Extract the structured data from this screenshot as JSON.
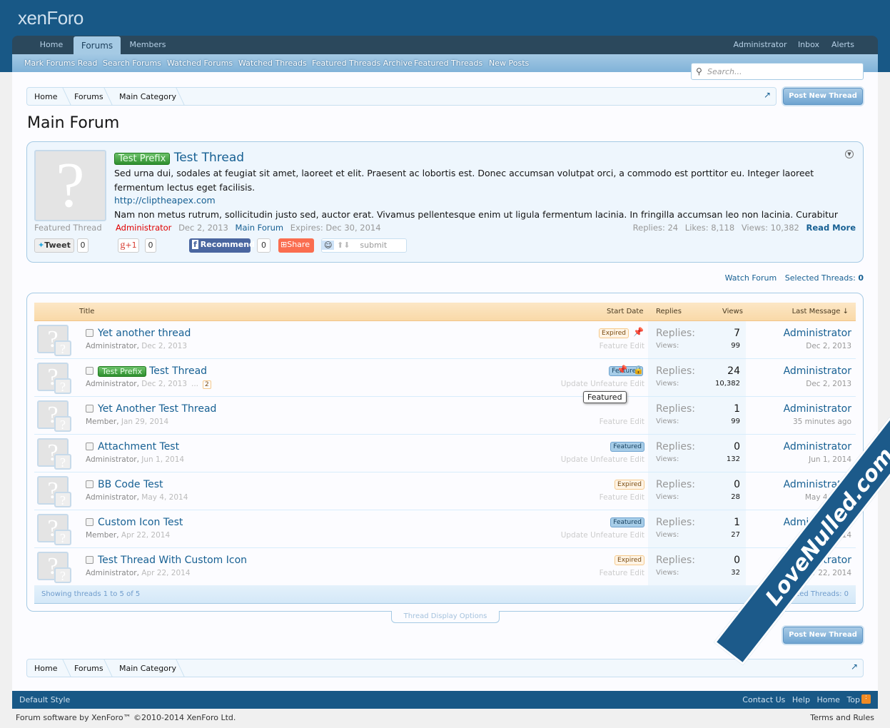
{
  "brand": {
    "logo": "xenForo"
  },
  "nav": {
    "tabs": [
      "Home",
      "Forums",
      "Members"
    ],
    "right": [
      "Administrator",
      "Inbox",
      "Alerts"
    ]
  },
  "subnav": [
    "Mark Forums Read",
    "Search Forums",
    "Watched Forums",
    "Watched Threads",
    "Featured Threads Archive",
    "Featured Threads",
    "New Posts"
  ],
  "search": {
    "placeholder": "Search..."
  },
  "breadcrumb": [
    "Home",
    "Forums",
    "Main Category"
  ],
  "post_button": "Post New Thread",
  "page_title": "Main Forum",
  "featured": {
    "prefix": "Test Prefix",
    "title": "Test Thread",
    "body1": "Sed urna dui, sodales at feugiat sit amet, laoreet et elit. Praesent ac lobortis est. Donec accumsan volutpat orci, a commodo est porttitor eu. Integer laoreet fermentum lectus eget facilisis.",
    "link": "http://cliptheapex.com",
    "body2": "Nam non metus rutrum, sollicitudin justo sed, auctor erat. Vivamus pellentesque enim ut ligula fermentum lacinia. In fringilla accumsan leo non lacinia. Curabitur",
    "label": "Featured Thread",
    "author": "Administrator",
    "date": "Dec 2, 2013",
    "forum": "Main Forum",
    "expires": "Expires: Dec 30, 2014",
    "replies": "Replies: 24",
    "likes": "Likes: 8,118",
    "views": "Views: 10,382",
    "read_more": "Read More",
    "share": {
      "tweet": "Tweet",
      "tweet_count": "0",
      "gplus": "+1",
      "gplus_count": "0",
      "recommend": "Recommend",
      "recommend_count": "0",
      "share": "Share",
      "submit": "submit"
    }
  },
  "list_controls": {
    "watch": "Watch Forum",
    "selected": "Selected Threads:",
    "selected_count": "0"
  },
  "columns": {
    "title": "Title",
    "start_date": "Start Date",
    "replies": "Replies",
    "views": "Views",
    "last_message": "Last Message ↓"
  },
  "stat_labels": {
    "replies": "Replies:",
    "views": "Views:"
  },
  "threads": [
    {
      "title": "Yet another thread",
      "prefix": "",
      "author": "Administrator",
      "date": "Dec 2, 2013",
      "badge": "Expired",
      "badge_type": "exp",
      "actions": "Feature Edit",
      "sticky": true,
      "locked": false,
      "replies": "7",
      "views": "99",
      "last_user": "Administrator",
      "last_date": "Dec 2, 2013"
    },
    {
      "title": "Test Thread",
      "prefix": "Test Prefix",
      "author": "Administrator",
      "date": "Dec 2, 2013",
      "pages": "2",
      "badge": "Featured",
      "badge_type": "feat",
      "actions": "Update Unfeature Edit",
      "sticky": true,
      "locked": true,
      "replies": "24",
      "views": "10,382",
      "last_user": "Administrator",
      "last_date": "Dec 2, 2013",
      "tooltip": "Featured"
    },
    {
      "title": "Yet Another Test Thread",
      "prefix": "",
      "author": "Member",
      "date": "Jan 29, 2014",
      "badge": "",
      "actions": "Feature Edit",
      "replies": "1",
      "views": "99",
      "last_user": "Administrator",
      "last_date": "35 minutes ago"
    },
    {
      "title": "Attachment Test",
      "prefix": "",
      "author": "Administrator",
      "date": "Jun 1, 2014",
      "badge": "Featured",
      "badge_type": "feat",
      "actions": "Update Unfeature Edit",
      "replies": "0",
      "views": "132",
      "last_user": "Administrator",
      "last_date": "Jun 1, 2014"
    },
    {
      "title": "BB Code Test",
      "prefix": "",
      "author": "Administrator",
      "date": "May 4, 2014",
      "badge": "Expired",
      "badge_type": "exp",
      "actions": "Feature Edit",
      "replies": "0",
      "views": "28",
      "last_user": "Administrator",
      "last_date": "May 4, 2014"
    },
    {
      "title": "Custom Icon Test",
      "prefix": "",
      "author": "Member",
      "date": "Apr 22, 2014",
      "badge": "Featured",
      "badge_type": "feat",
      "actions": "Update Unfeature Edit",
      "replies": "1",
      "views": "27",
      "last_user": "Administrator",
      "last_date": "Apr 22, 2014"
    },
    {
      "title": "Test Thread With Custom Icon",
      "prefix": "",
      "author": "Administrator",
      "date": "Apr 22, 2014",
      "badge": "Expired",
      "badge_type": "exp",
      "actions": "Feature Edit",
      "replies": "0",
      "views": "32",
      "last_user": "Administrator",
      "last_date": "Apr 22, 2014"
    }
  ],
  "list_footer": {
    "showing": "Showing threads 1 to 5 of 5",
    "selected": "Selected Threads: 0"
  },
  "display_options": "Thread Display Options",
  "footer": {
    "style": "Default Style",
    "links": [
      "Contact Us",
      "Help",
      "Home",
      "Top"
    ],
    "copyright": "Forum software by XenForo™ ©2010-2014 XenForo Ltd.",
    "terms": "Terms and Rules"
  },
  "watermark": "LoveNulled.com",
  "colors": {
    "header": "#185886",
    "accent": "#176093",
    "author_red": "#e00000"
  }
}
